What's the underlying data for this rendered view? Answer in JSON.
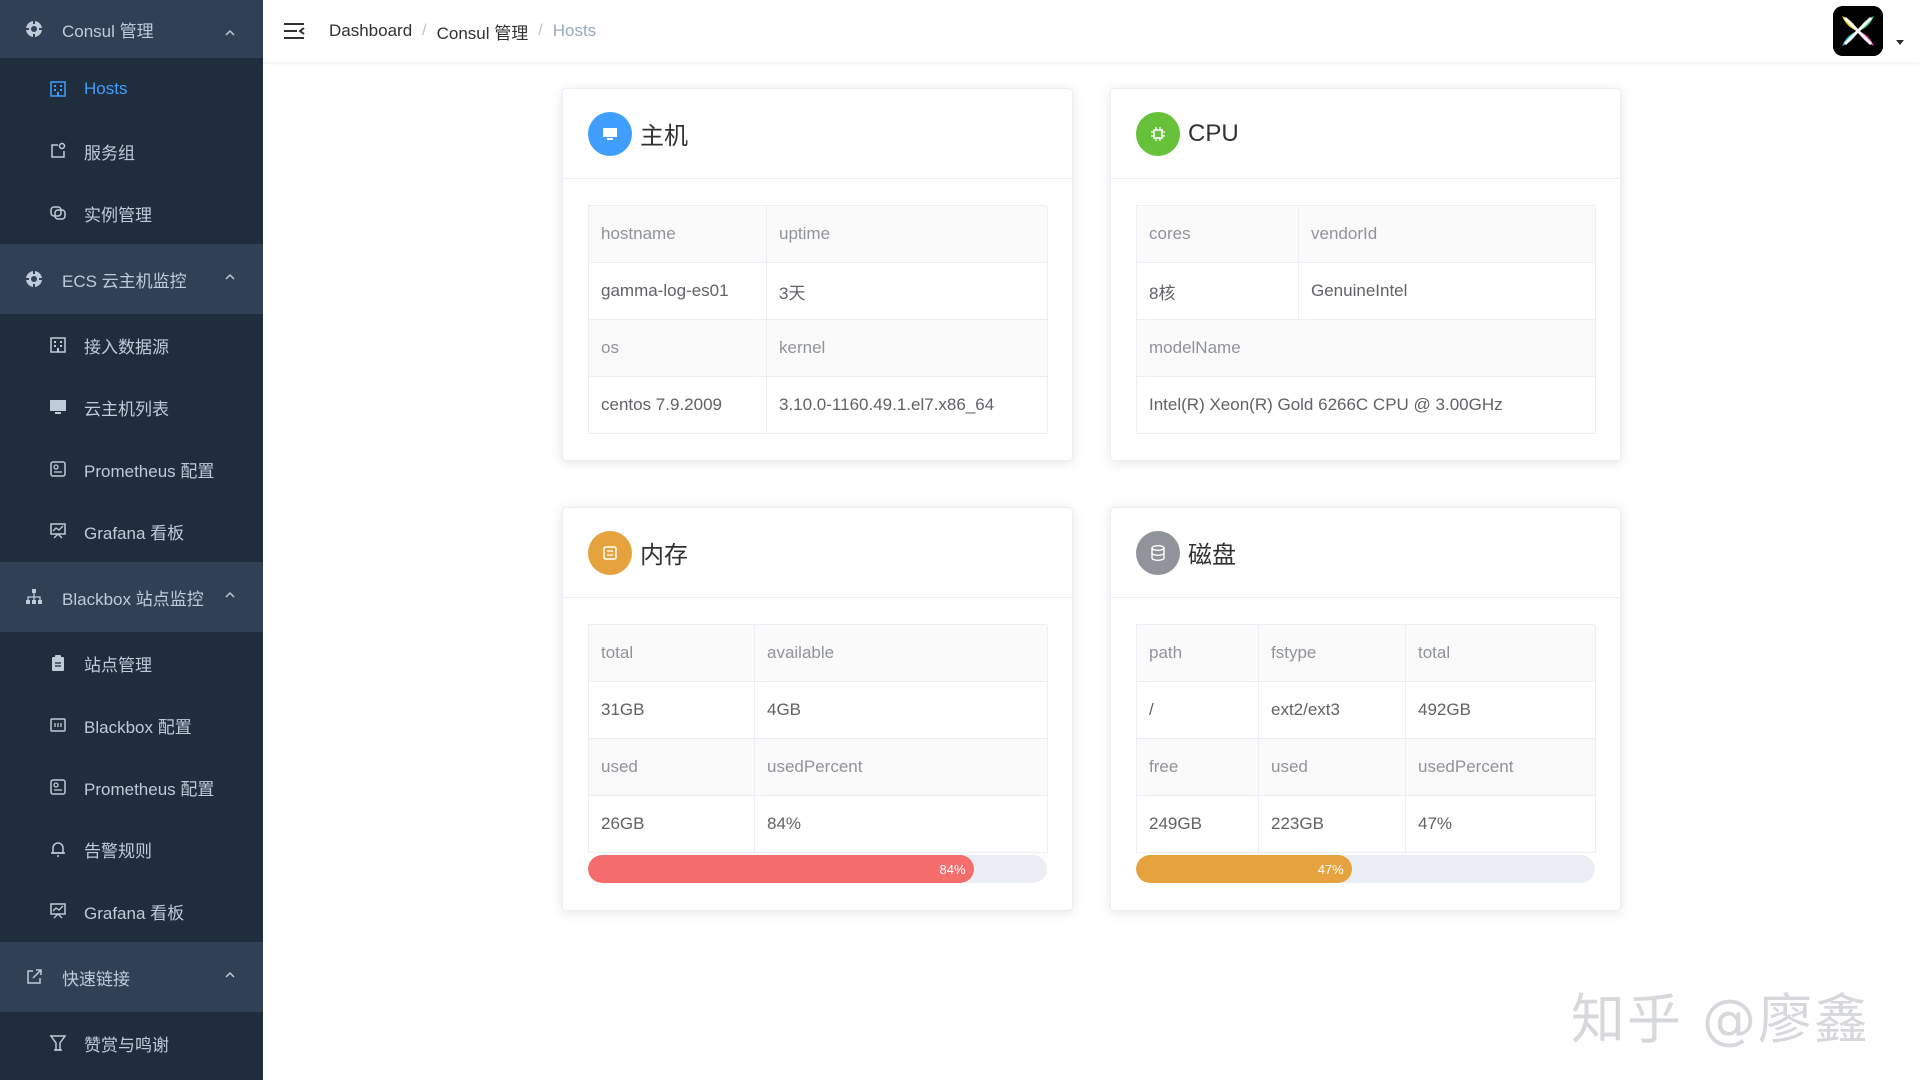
{
  "sidebar": {
    "groups": [
      {
        "label": "Consul 管理",
        "icon": "settings-icon",
        "items": [
          {
            "label": "Hosts",
            "icon": "building-icon",
            "active": true
          },
          {
            "label": "服务组",
            "icon": "window-icon"
          },
          {
            "label": "实例管理",
            "icon": "instances-icon"
          }
        ]
      },
      {
        "label": "ECS 云主机监控",
        "icon": "settings-icon",
        "items": [
          {
            "label": "接入数据源",
            "icon": "building-icon"
          },
          {
            "label": "云主机列表",
            "icon": "monitor-icon"
          },
          {
            "label": "Prometheus 配置",
            "icon": "config-icon"
          },
          {
            "label": "Grafana 看板",
            "icon": "board-icon"
          }
        ]
      },
      {
        "label": "Blackbox 站点监控",
        "icon": "sitemap-icon",
        "items": [
          {
            "label": "站点管理",
            "icon": "clipboard-icon"
          },
          {
            "label": "Blackbox 配置",
            "icon": "box-icon"
          },
          {
            "label": "Prometheus 配置",
            "icon": "config-icon"
          },
          {
            "label": "告警规则",
            "icon": "bell-icon"
          },
          {
            "label": "Grafana 看板",
            "icon": "board-icon"
          }
        ]
      },
      {
        "label": "快速链接",
        "icon": "external-link-icon",
        "items": [
          {
            "label": "赞赏与鸣谢",
            "icon": "trophy-icon"
          }
        ]
      }
    ]
  },
  "header": {
    "breadcrumb": [
      "Dashboard",
      "Consul 管理",
      "Hosts"
    ]
  },
  "cards": {
    "host": {
      "title": "主机",
      "icon_color": "#409eff",
      "rows": [
        [
          "hostname",
          "uptime"
        ],
        [
          "gamma-log-es01",
          "3天"
        ],
        [
          "os",
          "kernel"
        ],
        [
          "centos 7.9.2009",
          "3.10.0-1160.49.1.el7.x86_64"
        ]
      ]
    },
    "cpu": {
      "title": "CPU",
      "icon_color": "#67c23a",
      "rows": [
        [
          "cores",
          "vendorId"
        ],
        [
          "8核",
          "GenuineIntel"
        ],
        [
          "modelName"
        ],
        [
          "Intel(R) Xeon(R) Gold 6266C CPU @ 3.00GHz"
        ]
      ]
    },
    "memory": {
      "title": "内存",
      "icon_color": "#e6a23c",
      "rows": [
        [
          "total",
          "available"
        ],
        [
          "31GB",
          "4GB"
        ],
        [
          "used",
          "usedPercent"
        ],
        [
          "26GB",
          "84%"
        ]
      ],
      "progress_value": 84,
      "progress_label": "84%",
      "progress_color": "#f56c6c"
    },
    "disk": {
      "title": "磁盘",
      "icon_color": "#909399",
      "rows": [
        [
          "path",
          "fstype",
          "total"
        ],
        [
          "/",
          "ext2/ext3",
          "492GB"
        ],
        [
          "free",
          "used",
          "usedPercent"
        ],
        [
          "249GB",
          "223GB",
          "47%"
        ]
      ],
      "progress_value": 47,
      "progress_label": "47%",
      "progress_color": "#e6a23c"
    }
  },
  "watermark": "知乎 @廖鑫"
}
